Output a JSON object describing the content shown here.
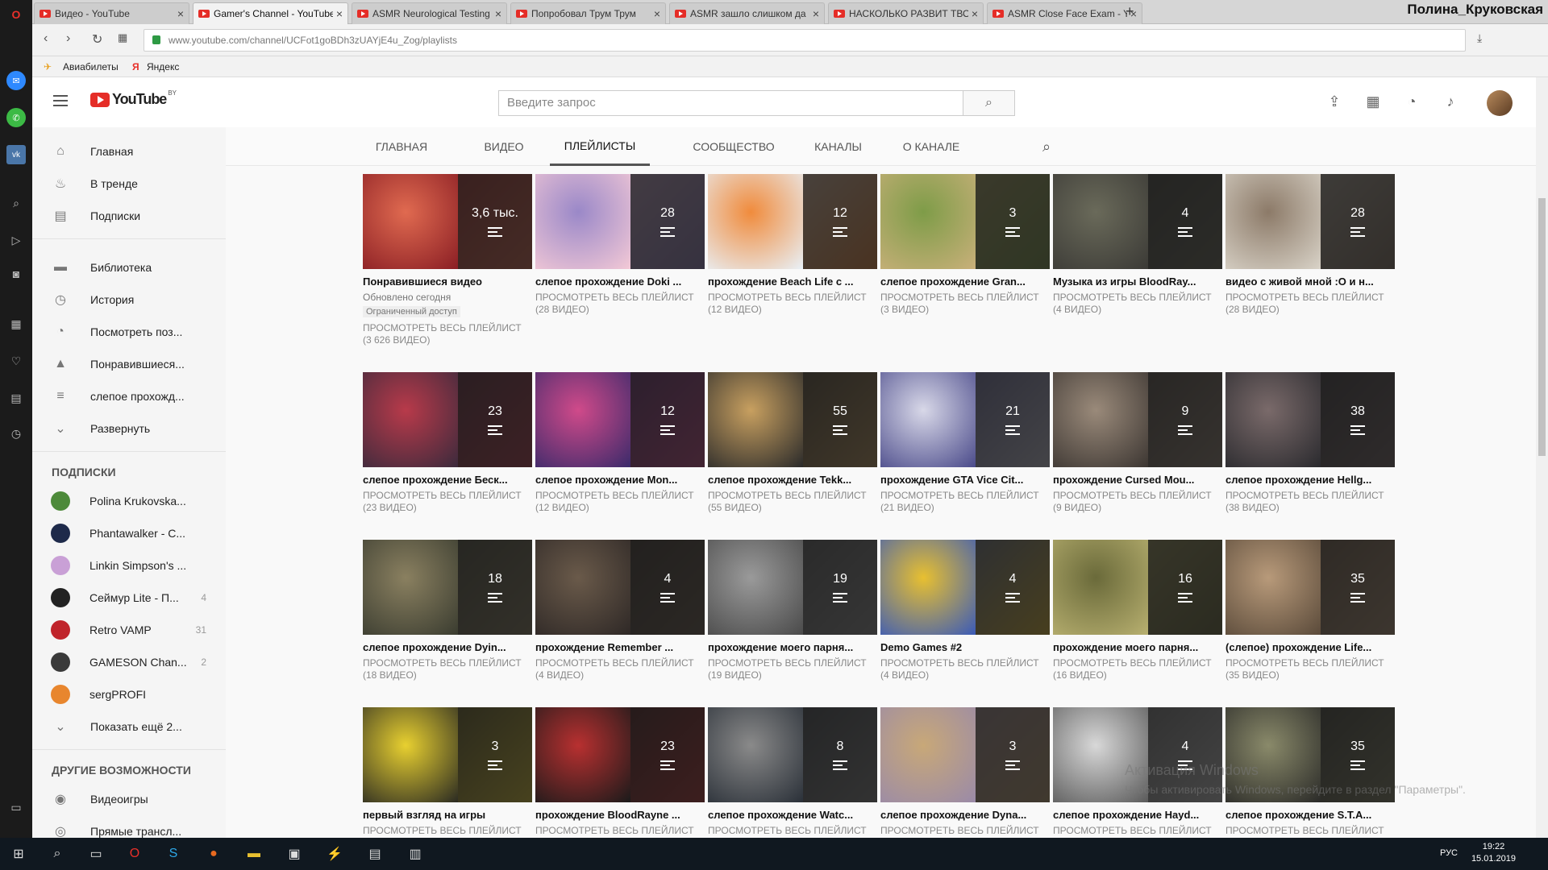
{
  "browser": {
    "tabs": [
      {
        "title": "Видео - YouTube",
        "active": false
      },
      {
        "title": "Gamer's Channel - YouTube",
        "active": true
      },
      {
        "title": "ASMR Neurological Testing",
        "active": false
      },
      {
        "title": "Попробовал Трум Трум",
        "active": false
      },
      {
        "title": "ASMR зашло слишком да",
        "active": false
      },
      {
        "title": "НАСКОЛЬКО РАЗВИТ ТВО",
        "active": false
      },
      {
        "title": "ASMR Close Face Exam - Y",
        "active": false
      }
    ],
    "profile_name": "Полина_Круковская",
    "url": "www.youtube.com/channel/UCFot1goBDh3zUAYjE4u_Zog/playlists",
    "bookmarks": [
      "Авиабилеты",
      "Яндекс"
    ]
  },
  "youtube": {
    "logo_text": "YouTube",
    "logo_region": "BY",
    "search_placeholder": "Введите запрос"
  },
  "sidebar": {
    "main_items": [
      {
        "label": "Главная",
        "icon": "home-icon"
      },
      {
        "label": "В тренде",
        "icon": "fire-icon"
      },
      {
        "label": "Подписки",
        "icon": "subscriptions-icon"
      }
    ],
    "library_items": [
      {
        "label": "Библиотека",
        "icon": "folder-icon"
      },
      {
        "label": "История",
        "icon": "history-icon"
      },
      {
        "label": "Посмотреть поз...",
        "icon": "clock-icon"
      },
      {
        "label": "Понравившиеся...",
        "icon": "thumbs-up-icon"
      },
      {
        "label": "слепое прохожд...",
        "icon": "playlist-icon"
      },
      {
        "label": "Развернуть",
        "icon": "chevron-down-icon"
      }
    ],
    "subscriptions_title": "ПОДПИСКИ",
    "subscriptions": [
      {
        "label": "Polina Krukovska...",
        "count": "",
        "color": "#4d8a3a"
      },
      {
        "label": "Phantawalker - C...",
        "count": "",
        "color": "#1e2a4a"
      },
      {
        "label": "Linkin Simpson's ...",
        "count": "",
        "color": "#c9a0d6"
      },
      {
        "label": "Сеймур Lite - П...",
        "count": "4",
        "color": "#222222"
      },
      {
        "label": "Retro VAMP",
        "count": "31",
        "color": "#c0242b"
      },
      {
        "label": "GAMESON Chan...",
        "count": "2",
        "color": "#3a3a3a"
      },
      {
        "label": "sergPROFI",
        "count": "",
        "color": "#e8862e"
      }
    ],
    "show_more": "Показать ещё 2...",
    "other_title": "ДРУГИЕ ВОЗМОЖНОСТИ",
    "other_items": [
      {
        "label": "Видеоигры",
        "icon": "gamepad-icon"
      },
      {
        "label": "Прямые трансл...",
        "icon": "live-icon"
      }
    ]
  },
  "channel_tabs": [
    "ГЛАВНАЯ",
    "ВИДЕО",
    "ПЛЕЙЛИСТЫ",
    "СООБЩЕСТВО",
    "КАНАЛЫ",
    "О КАНАЛЕ"
  ],
  "active_channel_tab": "ПЛЕЙЛИСТЫ",
  "playlist_link_text": "ПРОСМОТРЕТЬ ВЕСЬ ПЛЕЙЛИСТ",
  "playlists": [
    {
      "title": "Понравившиеся видео",
      "count": "3,6 тыс.",
      "updated": "Обновлено сегодня",
      "badge": "Ограниченный доступ",
      "videos": "(3 626 ВИДЕО)",
      "c1": "#8a1e24",
      "c2": "#e06a50"
    },
    {
      "title": "слепое прохождение Doki ...",
      "count": "28",
      "videos": "(28 ВИДЕО)",
      "c1": "#f3c9d6",
      "c2": "#9a88c8"
    },
    {
      "title": "прохождение Beach Life с ...",
      "count": "12",
      "videos": "(12 ВИДЕО)",
      "c1": "#e9f1f8",
      "c2": "#f08b3c"
    },
    {
      "title": "слепое прохождение Gran...",
      "count": "3",
      "videos": "(3 ВИДЕО)",
      "c1": "#c9b07a",
      "c2": "#7e9c48"
    },
    {
      "title": "Музыка из игры BloodRay...",
      "count": "4",
      "videos": "(4 ВИДЕО)",
      "c1": "#3b3a36",
      "c2": "#6a6a5a"
    },
    {
      "title": "видео с живой мной :О и н...",
      "count": "28",
      "videos": "(28 ВИДЕО)",
      "c1": "#d9d3c8",
      "c2": "#8c7a68"
    },
    {
      "title": "слепое прохождение Беск...",
      "count": "23",
      "videos": "(23 ВИДЕО)",
      "c1": "#3b2a3c",
      "c2": "#b83a4a"
    },
    {
      "title": "слепое прохождение Mon...",
      "count": "12",
      "videos": "(12 ВИДЕО)",
      "c1": "#3a2a6a",
      "c2": "#d04a8a"
    },
    {
      "title": "слепое прохождение Tekk...",
      "count": "55",
      "videos": "(55 ВИДЕО)",
      "c1": "#2a2a2a",
      "c2": "#c8a060"
    },
    {
      "title": "прохождение GTA Vice Cit...",
      "count": "21",
      "videos": "(21 ВИДЕО)",
      "c1": "#4a4a8a",
      "c2": "#d8d8e8"
    },
    {
      "title": "прохождение Cursed Mou...",
      "count": "9",
      "videos": "(9 ВИДЕО)",
      "c1": "#3c3632",
      "c2": "#9a8a7a"
    },
    {
      "title": "слепое прохождение Hellg...",
      "count": "38",
      "videos": "(38 ВИДЕО)",
      "c1": "#2a2a2e",
      "c2": "#7a6a6a"
    },
    {
      "title": "слепое прохождение Dyin...",
      "count": "18",
      "videos": "(18 ВИДЕО)",
      "c1": "#3a3c30",
      "c2": "#8a8060"
    },
    {
      "title": "прохождение Remember ...",
      "count": "4",
      "videos": "(4 ВИДЕО)",
      "c1": "#2e2826",
      "c2": "#6a5a4a"
    },
    {
      "title": "прохождение моего парня...",
      "count": "19",
      "videos": "(19 ВИДЕО)",
      "c1": "#4a4a4a",
      "c2": "#9a9a9a"
    },
    {
      "title": "Demo Games #2",
      "count": "4",
      "videos": "(4 ВИДЕО)",
      "c1": "#3a5ab8",
      "c2": "#e8c030"
    },
    {
      "title": "прохождение моего парня...",
      "count": "16",
      "videos": "(16 ВИДЕО)",
      "c1": "#b8b070",
      "c2": "#6a6a3a"
    },
    {
      "title": "(слепое) прохождение Life...",
      "count": "35",
      "videos": "(35 ВИДЕО)",
      "c1": "#5a4a3a",
      "c2": "#b89a7a"
    },
    {
      "title": "первый взгляд на игры",
      "count": "3",
      "videos": "",
      "c1": "#2a2a22",
      "c2": "#e8d030"
    },
    {
      "title": "прохождение BloodRayne ...",
      "count": "23",
      "videos": "",
      "c1": "#1a1a1a",
      "c2": "#b83030"
    },
    {
      "title": "слепое прохождение Watc...",
      "count": "8",
      "videos": "",
      "c1": "#2a3038",
      "c2": "#8a8a8a"
    },
    {
      "title": "слепое прохождение Dyna...",
      "count": "3",
      "videos": "",
      "c1": "#9a8aa8",
      "c2": "#c8a878"
    },
    {
      "title": "слепое прохождение Hayd...",
      "count": "4",
      "videos": "",
      "c1": "#5a5a5a",
      "c2": "#d8d8d8"
    },
    {
      "title": "слепое прохождение S.T.A...",
      "count": "35",
      "videos": "",
      "c1": "#2a2a28",
      "c2": "#8a8a6a"
    }
  ],
  "watermark": {
    "line1": "Активация Windows",
    "line2": "Чтобы активировать Windows, перейдите в раздел \"Параметры\"."
  },
  "taskbar": {
    "lang": "РУС",
    "time": "19:22",
    "date": "15.01.2019"
  }
}
